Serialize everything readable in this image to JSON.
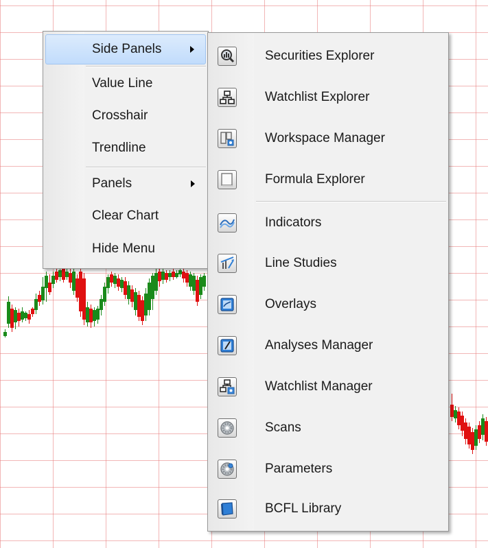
{
  "context_menu": {
    "items": [
      {
        "label": "Side Panels",
        "submenu": true,
        "highlighted": true
      },
      {
        "label": "Value Line"
      },
      {
        "label": "Crosshair"
      },
      {
        "label": "Trendline"
      },
      {
        "label": "Panels",
        "submenu": true
      },
      {
        "label": "Clear Chart"
      },
      {
        "label": "Hide Menu"
      }
    ]
  },
  "side_panels_submenu": {
    "items": [
      {
        "label": "Securities Explorer",
        "icon": "securities-explorer-icon"
      },
      {
        "label": "Watchlist Explorer",
        "icon": "watchlist-explorer-icon"
      },
      {
        "label": "Workspace Manager",
        "icon": "workspace-manager-icon"
      },
      {
        "label": "Formula Explorer",
        "icon": "formula-explorer-icon"
      },
      {
        "label": "Indicators",
        "icon": "indicators-icon"
      },
      {
        "label": "Line Studies",
        "icon": "line-studies-icon"
      },
      {
        "label": "Overlays",
        "icon": "overlays-icon"
      },
      {
        "label": "Analyses Manager",
        "icon": "analyses-manager-icon"
      },
      {
        "label": "Watchlist Manager",
        "icon": "watchlist-manager-icon"
      },
      {
        "label": "Scans",
        "icon": "scans-icon"
      },
      {
        "label": "Parameters",
        "icon": "parameters-icon"
      },
      {
        "label": "BCFL Library",
        "icon": "bcfl-library-icon"
      }
    ]
  },
  "colors": {
    "grid_line": "#e87a7a",
    "candle_up": "#1a8a1a",
    "candle_down": "#e01010",
    "highlight": "#c1dcfc"
  }
}
